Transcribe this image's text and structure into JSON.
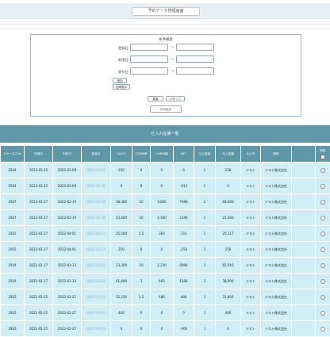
{
  "header": {
    "title": "予約データ管理画面"
  },
  "search": {
    "title": "条件検索",
    "rows": [
      {
        "label": "登録日:",
        "from": "",
        "to": ""
      },
      {
        "label": "利用日:",
        "from": "",
        "to": ""
      },
      {
        "label": "受付日:",
        "from": "",
        "to": ""
      }
    ],
    "tilde": "～",
    "small_buttons": [
      "追加",
      "在庫表示"
    ],
    "search_button": "検索",
    "reset_button": "リセット",
    "csv_button": "CSV出力"
  },
  "section": {
    "title": "仕入れ在庫一覧"
  },
  "table": {
    "columns": [
      "ステータスNo",
      "申請日",
      "利用日",
      "登録日",
      "SALES",
      "COMM率",
      "COMM額",
      "NET",
      "仕入数量",
      "仕入金額",
      "仕入先",
      "顧客",
      "",
      "削除"
    ],
    "header_last": "削除",
    "rows": [
      [
        "2924",
        "2022-02-25",
        "2022-03-06",
        "2022-02-25",
        "230",
        "0",
        "0",
        "0",
        "1",
        "230",
        "テスト",
        "テスト株式会社"
      ],
      [
        "2924",
        "2022-02-25",
        "2022-03-06",
        "2022-02-25",
        "0",
        "0",
        "0",
        "-914",
        "1",
        "0",
        "テスト",
        "テスト株式会社"
      ],
      [
        "2927",
        "2022-02-27",
        "2022-03-19",
        "2022-02-28",
        "38,300",
        "10",
        "3,830",
        "7668",
        "2",
        "68,940",
        "テスト",
        "テスト株式会社"
      ],
      [
        "2927",
        "2022-02-27",
        "2022-03-19",
        "2022-02-28",
        "23,400",
        "10",
        "2,340",
        "2340",
        "1",
        "21,060",
        "テスト",
        "テスト株式会社"
      ],
      [
        "2925",
        "2022-02-27",
        "2022-04-01",
        "2022-02-27",
        "25,500",
        "1.5",
        "383",
        "733",
        "1",
        "25,117",
        "テスト",
        "テスト株式会社"
      ],
      [
        "2925",
        "2022-02-27",
        "2022-04-01",
        "2022-02-27",
        "250",
        "0",
        "0",
        "-250",
        "1",
        "250",
        "テスト",
        "テスト株式会社"
      ],
      [
        "2924",
        "2022-02-27",
        "2022-03-13",
        "2022-03-01",
        "23,300",
        "10",
        "2,330",
        "6990",
        "3",
        "62,910",
        "テスト",
        "テスト株式会社"
      ],
      [
        "2924",
        "2022-02-27",
        "2022-03-13",
        "2022-03-01",
        "41,400",
        "3",
        "402",
        "1206",
        "3",
        "38,994",
        "テスト",
        "テスト株式会社"
      ],
      [
        "2923",
        "2022-02-25",
        "2022-02-27",
        "2022-02-25",
        "32,250",
        "1.5",
        "486",
        "486",
        "1",
        "31,804",
        "テスト",
        "テスト株式会社"
      ],
      [
        "2923",
        "2022-02-25",
        "2022-02-27",
        "2022-02-25",
        "400",
        "0",
        "0",
        "0",
        "1",
        "400",
        "テスト",
        "テスト株式会社"
      ],
      [
        "2923",
        "2022-02-25",
        "2022-02-27",
        "2022-02-25",
        "0",
        "0",
        "0",
        "-909",
        "1",
        "0",
        "テスト",
        "テスト株式会社"
      ]
    ]
  }
}
